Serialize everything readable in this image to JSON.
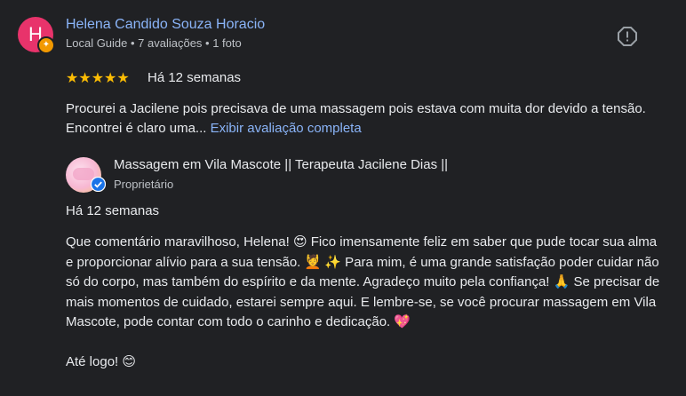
{
  "reviewer": {
    "initial": "H",
    "name": "Helena Candido Souza Horacio",
    "meta": "Local Guide • 7 avaliações • 1 foto"
  },
  "review": {
    "stars": "★★★★★",
    "rating": 5,
    "date": "Há 12 semanas",
    "text": "Procurei a Jacilene pois precisava de uma massagem pois estava com muita dor devido a tensão. Encontrei é claro uma...",
    "more_link": "Exibir avaliação completa"
  },
  "owner_reply": {
    "name": "Massagem em Vila Mascote || Terapeuta Jacilene Dias ||",
    "role": "Proprietário",
    "date": "Há 12 semanas",
    "text": "Que comentário maravilhoso, Helena! 😍 Fico imensamente feliz em saber que pude tocar sua alma e proporcionar alívio para a sua tensão. 💆 ✨ Para mim, é uma grande satisfação poder cuidar não só do corpo, mas também do espírito e da mente. Agradeço muito pela confiança! 🙏 Se precisar de mais momentos de cuidado, estarei sempre aqui. E lembre-se, se você procurar massagem em Vila Mascote, pode contar com todo o carinho e dedicação. 💖",
    "signoff": "Até logo! 😊"
  },
  "icons": {
    "badge": "local-guide-badge-icon",
    "report": "report-flag-icon",
    "verified": "verified-check-icon"
  },
  "colors": {
    "background": "#202124",
    "link": "#8ab4f8",
    "star": "#fbbc04",
    "avatar": "#e8336b",
    "badge": "#f29900",
    "verified": "#1a73e8"
  }
}
